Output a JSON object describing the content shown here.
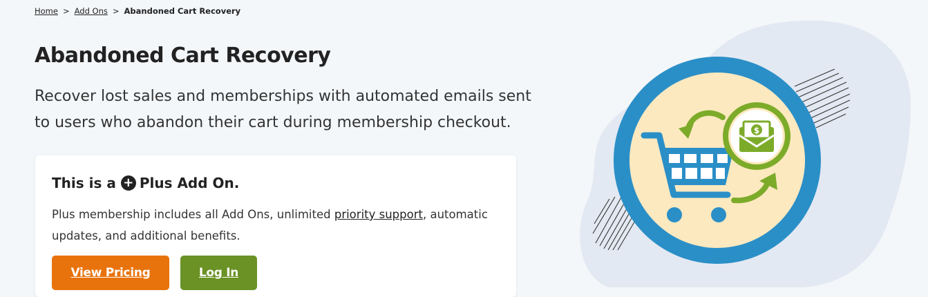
{
  "breadcrumb": {
    "home": "Home",
    "sep1": ">",
    "addons": "Add Ons",
    "sep2": ">",
    "current": "Abandoned Cart Recovery"
  },
  "page": {
    "title": "Abandoned Cart Recovery",
    "subtitle": "Recover lost sales and memberships with automated emails sent to users who abandon their cart during membership checkout."
  },
  "card": {
    "title_before": "This is a",
    "plus_glyph": "+",
    "title_after": "Plus Add On.",
    "body_before": "Plus membership includes all Add Ons, unlimited ",
    "body_link": "priority support",
    "body_after": ", automatic updates, and additional benefits.",
    "pricing_button": "View Pricing",
    "login_button": "Log In"
  },
  "hero": {
    "icons": [
      "shopping-cart-icon",
      "money-envelope-icon",
      "return-arrow-icon"
    ],
    "colors": {
      "ring": "#2b8fc7",
      "fill": "#fde9bf",
      "cart": "#2b8fc7",
      "arrows": "#7cab2a",
      "blob": "#e3e9f2"
    }
  }
}
